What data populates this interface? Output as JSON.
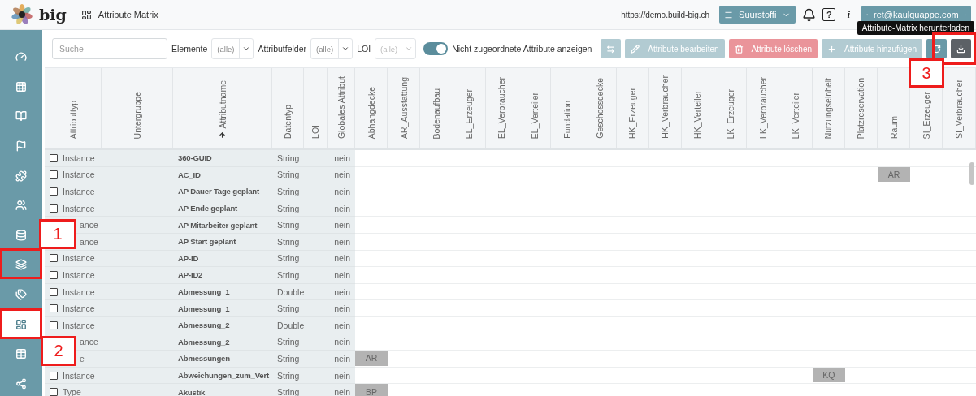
{
  "header": {
    "brand": "big",
    "page_title": "Attribute Matrix",
    "url": "https://demo.build-big.ch",
    "project": "Suurstoffi",
    "help_label": "?",
    "info_label": "i",
    "user": "ret@kaulquappe.com"
  },
  "tooltip": "Attribute-Matrix herunterladen",
  "sidebar": {
    "items": [
      {
        "selected": false
      },
      {
        "selected": false
      },
      {
        "selected": false
      },
      {
        "selected": false
      },
      {
        "selected": false
      },
      {
        "selected": false
      },
      {
        "selected": false
      },
      {
        "selected": false
      },
      {
        "selected": false
      },
      {
        "selected": true
      },
      {
        "selected": false
      },
      {
        "selected": false
      }
    ]
  },
  "toolbar": {
    "search": {
      "placeholder": "Suche"
    },
    "filters": [
      {
        "label": "Elemente",
        "value": "(alle)",
        "disabled": false
      },
      {
        "label": "Attributfelder",
        "value": "(alle)",
        "disabled": false
      },
      {
        "label": "LOI",
        "value": "(alle)",
        "disabled": true
      }
    ],
    "toggle": {
      "on": true,
      "label": "Nicht zugeordnete Attribute anzeigen"
    },
    "buttons": [
      {
        "kind": "swap",
        "disabled": true
      },
      {
        "kind": "edit",
        "label": "Attribute bearbeiten",
        "disabled": true
      },
      {
        "kind": "delete",
        "label": "Attribute löschen",
        "disabled": true
      },
      {
        "kind": "add",
        "label": "Attribute hinzufügen",
        "disabled": true
      },
      {
        "kind": "refresh",
        "disabled": false
      },
      {
        "kind": "download",
        "disabled": false
      }
    ]
  },
  "table": {
    "columns": [
      {
        "label": "Attributtyp",
        "sorted": false
      },
      {
        "label": "Untergruppe",
        "sorted": false
      },
      {
        "label": "Attributname",
        "sorted": true
      },
      {
        "label": "Datentyp",
        "sorted": false
      },
      {
        "label": "LOI",
        "sorted": false
      },
      {
        "label": "Globales Attribut",
        "sorted": false
      }
    ],
    "element_columns": [
      "Abhangdecke",
      "AR_Ausstattung",
      "Bodenaufbau",
      "EL_Erzeuger",
      "EL_Verbraucher",
      "EL_Verteiler",
      "Fundation",
      "Geschossdecke",
      "HK_Erzeuger",
      "HK_Verbraucher",
      "HK_Verteiler",
      "LK_Erzeuger",
      "LK_Verbraucher",
      "LK_Verteiler",
      "Nutzungseinheit",
      "Platzreservation",
      "Raum",
      "SI_Erzeuger",
      "SI_Verbraucher"
    ],
    "rows": [
      {
        "checked": false,
        "type": "Instance",
        "name": "360-GUID",
        "datatype": "String",
        "global": "nein"
      },
      {
        "checked": false,
        "type": "Instance",
        "name": "AC_ID",
        "datatype": "String",
        "global": "nein",
        "cells": [
          null,
          null,
          null,
          null,
          null,
          null,
          null,
          null,
          null,
          null,
          null,
          null,
          null,
          null,
          null,
          null,
          "AR"
        ]
      },
      {
        "checked": false,
        "type": "Instance",
        "name": "AP Dauer Tage geplant",
        "datatype": "String",
        "global": "nein"
      },
      {
        "checked": false,
        "type": "Instance",
        "name": "AP Ende geplant",
        "datatype": "String",
        "global": "nein"
      },
      {
        "type": "ance",
        "name": "AP Mitarbeiter geplant",
        "datatype": "String",
        "global": "nein"
      },
      {
        "type": "ance",
        "name": "AP Start geplant",
        "datatype": "String",
        "global": "nein"
      },
      {
        "checked": false,
        "type": "Instance",
        "name": "AP-ID",
        "datatype": "String",
        "global": "nein"
      },
      {
        "checked": false,
        "type": "Instance",
        "name": "AP-ID2",
        "datatype": "String",
        "global": "nein"
      },
      {
        "checked": false,
        "type": "Instance",
        "name": "Abmessung_1",
        "datatype": "Double",
        "global": "nein"
      },
      {
        "checked": false,
        "type": "Instance",
        "name": "Abmessung_1",
        "datatype": "String",
        "global": "nein"
      },
      {
        "checked": false,
        "type": "Instance",
        "name": "Abmessung_2",
        "datatype": "Double",
        "global": "nein"
      },
      {
        "type": "ance",
        "name": "Abmessung_2",
        "datatype": "String",
        "global": "nein"
      },
      {
        "type": "e",
        "name": "Abmessungen",
        "datatype": "String",
        "global": "nein",
        "cells": [
          "AR"
        ]
      },
      {
        "checked": false,
        "type": "Instance",
        "name": "Abweichungen_zum_Vert",
        "datatype": "String",
        "global": "nein",
        "cells": [
          null,
          null,
          null,
          null,
          null,
          null,
          null,
          null,
          null,
          null,
          null,
          null,
          null,
          null,
          "KQ"
        ]
      },
      {
        "checked": false,
        "type": "Type",
        "name": "Akustik",
        "datatype": "String",
        "global": "nein",
        "cells": [
          "BP"
        ]
      }
    ]
  },
  "annotations": [
    {
      "label": "1"
    },
    {
      "label": "2"
    },
    {
      "label": "3"
    }
  ]
}
